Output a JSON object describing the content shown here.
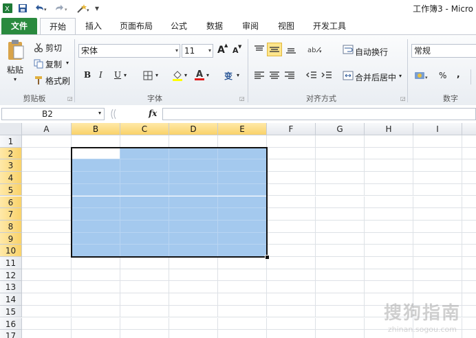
{
  "window": {
    "title": "工作簿3 - Micro"
  },
  "quick_access": {
    "excel_icon": "excel-icon",
    "save_icon": "save-icon",
    "undo_icon": "undo-icon",
    "redo_icon": "redo-icon",
    "tool_icon": "wand-icon",
    "customize": "▾"
  },
  "tabs": [
    {
      "label": "文件"
    },
    {
      "label": "开始"
    },
    {
      "label": "插入"
    },
    {
      "label": "页面布局"
    },
    {
      "label": "公式"
    },
    {
      "label": "数据"
    },
    {
      "label": "审阅"
    },
    {
      "label": "视图"
    },
    {
      "label": "开发工具"
    }
  ],
  "ribbon": {
    "clipboard": {
      "paste": "粘贴",
      "cut": "剪切",
      "copy": "复制",
      "format_painter": "格式刷",
      "label": "剪贴板"
    },
    "font": {
      "name": "宋体",
      "size": "11",
      "grow": "A",
      "shrink": "A",
      "bold": "B",
      "italic": "I",
      "underline": "U",
      "phonetic": "变",
      "label": "字体"
    },
    "alignment": {
      "wrap": "自动换行",
      "merge": "合并后居中",
      "label": "对齐方式"
    },
    "number": {
      "format": "常规",
      "percent": "%",
      "comma": ",",
      "label": "数字"
    }
  },
  "formula_bar": {
    "name_box": "B2",
    "fx": "fx",
    "value": ""
  },
  "grid": {
    "columns": [
      "A",
      "B",
      "C",
      "D",
      "E",
      "F",
      "G",
      "H",
      "I"
    ],
    "rows": [
      "1",
      "2",
      "3",
      "4",
      "5",
      "6",
      "7",
      "8",
      "9",
      "10",
      "11",
      "12",
      "13",
      "14",
      "15",
      "16",
      "17"
    ],
    "selected_columns": [
      "B",
      "C",
      "D",
      "E"
    ],
    "selected_rows": [
      "2",
      "3",
      "4",
      "5",
      "6",
      "7",
      "8",
      "9",
      "10"
    ],
    "active_cell": "B2"
  },
  "colors": {
    "file_tab": "#2a8a3e",
    "selection": "#a4c9ee",
    "header_highlight": "#f9d26a"
  },
  "watermark": {
    "text": "搜狗指南",
    "sub": "zhinan.sogou.com"
  }
}
